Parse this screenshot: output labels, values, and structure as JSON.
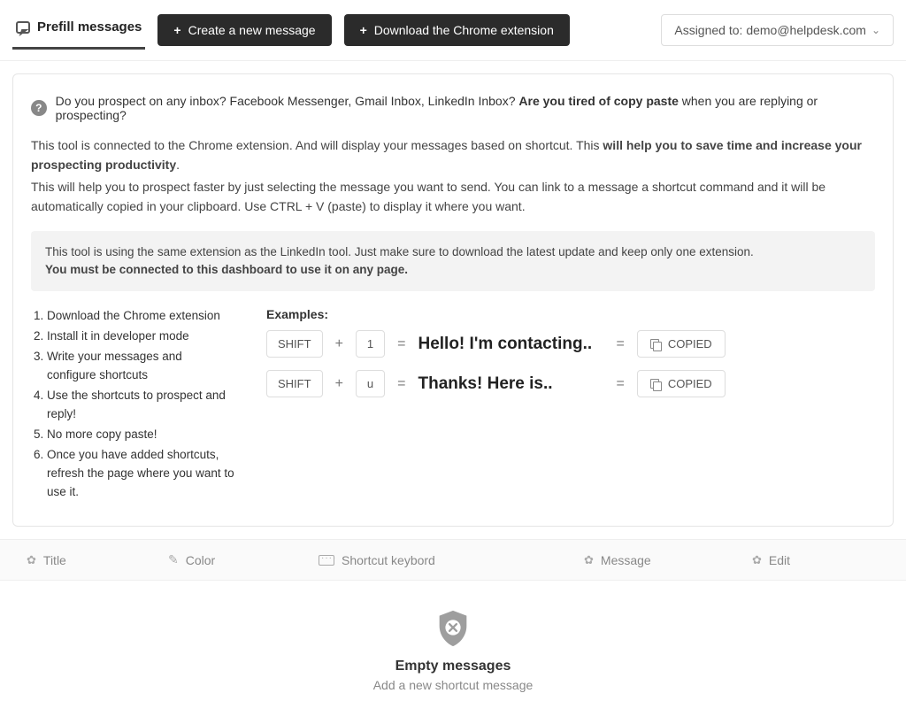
{
  "header": {
    "tab_label": "Prefill messages",
    "create_btn": "Create a new message",
    "download_btn": "Download the Chrome extension",
    "assigned_prefix": "Assigned to:",
    "assigned_value": "demo@helpdesk.com"
  },
  "intro": {
    "q1": "Do you prospect on any inbox? Facebook Messenger, Gmail Inbox, LinkedIn Inbox?",
    "q1_bold": "Are you tired of copy paste",
    "q1_tail": "when you are replying or prospecting?",
    "p1_a": "This tool is connected to the Chrome extension. And will display your messages based on shortcut. This",
    "p1_bold": "will help you to save time and increase your prospecting productivity",
    "p1_c": ".",
    "p2": "This will help you to prospect faster by just selecting the message you want to send. You can link to a message a shortcut command and it will be automatically copied in your clipboard. Use CTRL + V (paste) to display it where you want."
  },
  "notice": {
    "line1": "This tool is using the same extension as the LinkedIn tool. Just make sure to download the latest update and keep only one extension.",
    "line2": "You must be connected to this dashboard to use it on any page."
  },
  "steps": [
    "Download the Chrome extension",
    "Install it in developer mode",
    "Write your messages and configure shortcuts",
    "Use the shortcuts to prospect and reply!",
    "No more copy paste!",
    "Once you have added shortcuts, refresh the page where you want to use it."
  ],
  "examples": {
    "title": "Examples:",
    "rows": [
      {
        "k1": "SHIFT",
        "plus": "+",
        "k2": "1",
        "eq1": "=",
        "msg": "Hello! I'm contacting..",
        "eq2": "=",
        "copied": "COPIED"
      },
      {
        "k1": "SHIFT",
        "plus": "+",
        "k2": "u",
        "eq1": "=",
        "msg": "Thanks! Here is..",
        "eq2": "=",
        "copied": "COPIED"
      }
    ]
  },
  "columns": {
    "title": "Title",
    "color": "Color",
    "shortcut": "Shortcut keybord",
    "message": "Message",
    "edit": "Edit"
  },
  "empty": {
    "title": "Empty messages",
    "subtitle": "Add a new shortcut message"
  }
}
